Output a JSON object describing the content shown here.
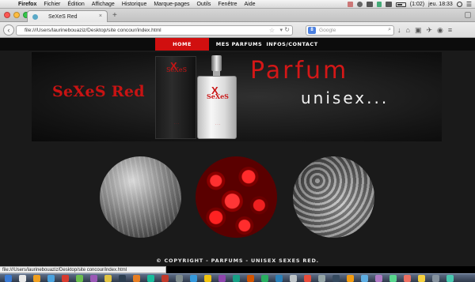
{
  "menubar": {
    "app": "Firefox",
    "items": [
      "Fichier",
      "Édition",
      "Affichage",
      "Historique",
      "Marque-pages",
      "Outils",
      "Fenêtre",
      "Aide"
    ],
    "battery": "(1:02)",
    "clock": "jeu. 18:33"
  },
  "browser": {
    "tab_title": "SeXeS Red",
    "url": "file:///Users/laurinebouaziz/Desktop/site concour/index.html",
    "search_engine_letter": "8",
    "search_placeholder": "Google",
    "status_url": "file:///Users/laurinebouaziz/Desktop/site concour/index.html"
  },
  "site": {
    "nav": {
      "home": "HOME",
      "parfums": "MES PARFUMS",
      "infos": "INFOS/CONTACT"
    },
    "banner": {
      "brand": "SeXeS Red",
      "title_line1": "Parfum",
      "title_line2": "unisex...",
      "box_label": "SeXeS",
      "bottle_label": "SeXeS"
    },
    "footer": "© COPYRIGHT - PARFUMS - UNISEX SEXES RED."
  },
  "colors": {
    "accent_red": "#d10f0f",
    "page_bg": "#1a1a1a"
  },
  "dock_colors": [
    "#3a7bd5",
    "#e8e8e8",
    "#f0a020",
    "#4aa3df",
    "#d83b2f",
    "#6bbf4e",
    "#9b59b6",
    "#e0c341",
    "#2c3e50",
    "#e67e22",
    "#1abc9c",
    "#c0392b",
    "#7f8c8d",
    "#3498db",
    "#f1c40f",
    "#8e44ad",
    "#16a085",
    "#d35400",
    "#27ae60",
    "#2980b9",
    "#bdc3c7",
    "#e74c3c",
    "#95a5a6",
    "#34495e",
    "#f39c12",
    "#5dade2",
    "#af7ac5",
    "#58d68d",
    "#ec7063",
    "#f4d03f",
    "#85929e",
    "#48c9b0"
  ]
}
